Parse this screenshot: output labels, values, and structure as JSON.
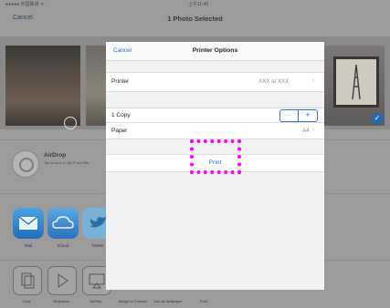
{
  "status_bar": {
    "carrier": "●●●●● 中国联通 ᯤ",
    "time": "上午11:46"
  },
  "navbar": {
    "cancel_label": "Cancel",
    "title": "1 Photo Selected"
  },
  "airdrop": {
    "title": "AirDrop",
    "subtitle": "Tap to turn on Wi-Fi and Blu"
  },
  "share_apps": [
    {
      "label": "Mail",
      "icon": "mail-icon"
    },
    {
      "label": "iCloud",
      "icon": "icloud-icon"
    },
    {
      "label": "Twitter",
      "icon": "twitter-icon"
    }
  ],
  "actions": [
    {
      "label": "Copy",
      "icon": "copy-icon"
    },
    {
      "label": "Slideshow",
      "icon": "slideshow-icon"
    },
    {
      "label": "AirPlay",
      "icon": "airplay-icon"
    },
    {
      "label": "Assign to Contact",
      "icon": "contact-icon"
    },
    {
      "label": "Use as Wallpaper",
      "icon": "wallpaper-icon"
    },
    {
      "label": "Print",
      "icon": "print-icon"
    }
  ],
  "printer_options": {
    "cancel_label": "Cancel",
    "title": "Printer Options",
    "printer_label": "Printer",
    "printer_value": "XXX at XXX",
    "copies_label": "1 Copy",
    "stepper_minus": "−",
    "stepper_plus": "+",
    "paper_label": "Paper",
    "paper_value": "A4",
    "print_label": "Print"
  },
  "colors": {
    "accent": "#2a6fd6",
    "highlight": "#ff00ff",
    "dim_overlay": "#9b9b9b"
  }
}
